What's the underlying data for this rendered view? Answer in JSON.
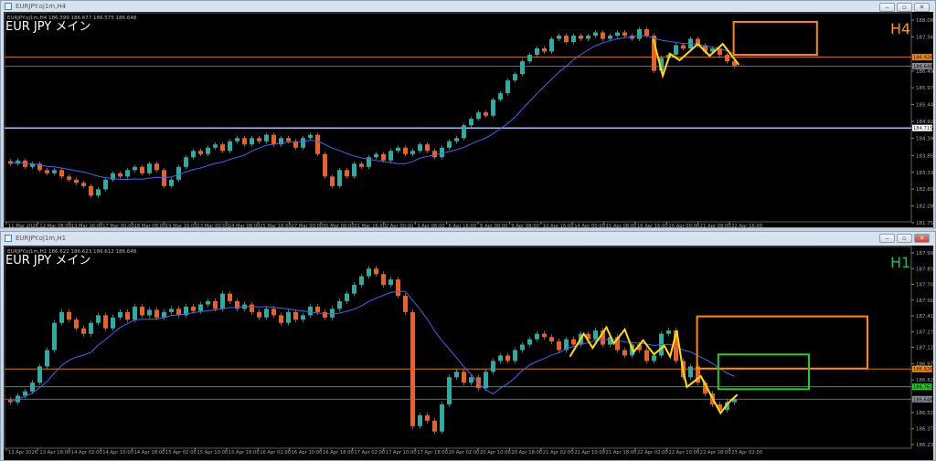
{
  "windows": [
    {
      "title": "EURJPY.oj1m,H4",
      "info": "EURJPY.oj1m,H4  186.599 186.677 186.575 186.648",
      "heading": "EUR JPY  メイン",
      "timeframe_label": "H4",
      "buttons": [
        "‒",
        "▫",
        "✕"
      ]
    },
    {
      "title": "EURJPY.oj1m,H1",
      "info": "EURJPY.oj1m,H1  186.622 186.623 186.612 186.648",
      "heading": "EUR JPY  メイン",
      "timeframe_label": "H1",
      "buttons": [
        "‒",
        "▫",
        "✕"
      ]
    }
  ],
  "colors": {
    "bull": "#1fb3a6",
    "bear": "#ff5a1a",
    "ma": "#4466ee",
    "zigzag": "#ffe000",
    "orange": "#ff8c00",
    "green": "#22cc22",
    "blueline": "#aab8ff"
  },
  "chart_data": [
    {
      "type": "candlestick",
      "title": "EURJPY H4",
      "ylim": [
        181.755,
        188.085
      ],
      "y_ticks": [
        "188.085",
        "187.560",
        "186.495",
        "185.970",
        "185.445",
        "184.920",
        "184.395",
        "183.855",
        "183.330",
        "182.805",
        "182.280",
        "181.755"
      ],
      "x_ticks": [
        "11 Mar 2026",
        "12 Mar 08:00",
        "13 Mar 16:00",
        "17 Mar 00:00",
        "18 Mar 08:00",
        "19 Mar 16:00",
        "23 Mar 00:00",
        "24 Mar 08:00",
        "25 Mar 16:00",
        "27 Mar 00:00",
        "30 Mar 08:00",
        "31 Mar 16:00",
        "2 Apr 00:00",
        "3 Apr 08:00",
        "6 Apr 16:00",
        "8 Apr 00:00",
        "9 Apr 08:00",
        "10 Apr 16:00",
        "14 Apr 00:00",
        "15 Apr 08:00",
        "16 Apr 16:00",
        "20 Apr 00:00",
        "21 Apr 08:00",
        "22 Apr 16:00"
      ],
      "closes": [
        183.6,
        183.7,
        183.5,
        183.6,
        183.4,
        183.3,
        183.4,
        183.2,
        183.1,
        183.0,
        182.9,
        182.6,
        182.8,
        183.1,
        183.3,
        183.2,
        183.4,
        183.5,
        183.3,
        183.6,
        183.4,
        182.9,
        183.1,
        183.5,
        183.8,
        184.0,
        183.9,
        184.1,
        184.2,
        184.0,
        184.3,
        184.4,
        184.2,
        184.4,
        184.3,
        184.5,
        184.2,
        184.4,
        184.3,
        184.1,
        184.4,
        184.5,
        183.9,
        183.2,
        182.9,
        183.4,
        183.2,
        183.6,
        183.5,
        183.8,
        183.9,
        183.7,
        184.0,
        184.1,
        183.9,
        184.0,
        184.2,
        184.0,
        183.8,
        184.1,
        184.3,
        184.4,
        184.8,
        185.0,
        185.2,
        185.1,
        185.6,
        185.8,
        186.2,
        186.4,
        186.8,
        187.0,
        187.2,
        187.1,
        187.5,
        187.6,
        187.4,
        187.6,
        187.5,
        187.6,
        187.7,
        187.5,
        187.6,
        187.7,
        187.6,
        187.5,
        187.8,
        187.6,
        186.5,
        186.9,
        187.0,
        187.3,
        187.2,
        187.5,
        187.3,
        187.1,
        187.2,
        187.0,
        186.8,
        186.65
      ],
      "hlines": [
        {
          "price": 186.926,
          "label": "186.926",
          "color": "orange"
        },
        {
          "price": 186.648,
          "label": "186.648",
          "color": "gray"
        },
        {
          "price": 184.715,
          "label": "184.715",
          "color": "blueline"
        }
      ],
      "zigzag": [
        [
          87.9,
          187.49
        ],
        [
          89.2,
          186.35
        ],
        [
          90.2,
          187.03
        ],
        [
          91.5,
          186.83
        ],
        [
          94,
          187.34
        ],
        [
          95.6,
          186.97
        ],
        [
          97.4,
          187.34
        ],
        [
          99.6,
          186.69
        ]
      ],
      "boxes": [
        {
          "from": 99.2,
          "to": 110.6,
          "top": 188.03,
          "bottom": 187.0,
          "color": "orange"
        }
      ]
    },
    {
      "type": "candlestick",
      "title": "EURJPY H1",
      "ylim": [
        186.23,
        187.995
      ],
      "y_ticks": [
        "187.995",
        "187.850",
        "187.705",
        "187.560",
        "187.415",
        "187.270",
        "187.125",
        "186.975",
        "186.825",
        "186.525",
        "186.375",
        "186.230"
      ],
      "x_ticks": [
        "13 Apr 2026",
        "13 Apr 18:00",
        "14 Apr 02:00",
        "14 Apr 10:00",
        "14 Apr 18:00",
        "15 Apr 02:00",
        "15 Apr 10:00",
        "15 Apr 18:00",
        "16 Apr 02:00",
        "16 Apr 10:00",
        "16 Apr 18:00",
        "17 Apr 02:00",
        "17 Apr 10:00",
        "17 Apr 18:00",
        "20 Apr 02:00",
        "20 Apr 10:00",
        "20 Apr 18:00",
        "21 Apr 02:00",
        "21 Apr 10:00",
        "21 Apr 18:00",
        "22 Apr 02:00",
        "22 Apr 10:00",
        "22 Apr 18:00",
        "23 Apr 02:00"
      ],
      "closes": [
        186.62,
        186.68,
        186.72,
        186.8,
        186.95,
        187.1,
        187.35,
        187.45,
        187.38,
        187.3,
        187.25,
        187.35,
        187.42,
        187.3,
        187.4,
        187.45,
        187.38,
        187.5,
        187.42,
        187.47,
        187.4,
        187.45,
        187.48,
        187.42,
        187.5,
        187.46,
        187.52,
        187.55,
        187.48,
        187.62,
        187.55,
        187.48,
        187.52,
        187.45,
        187.4,
        187.48,
        187.42,
        187.35,
        187.45,
        187.38,
        187.42,
        187.5,
        187.45,
        187.4,
        187.48,
        187.55,
        187.62,
        187.7,
        187.78,
        187.85,
        187.8,
        187.7,
        187.75,
        187.6,
        187.45,
        186.4,
        186.5,
        186.45,
        186.35,
        186.6,
        186.85,
        186.9,
        186.8,
        186.85,
        186.75,
        186.9,
        187.0,
        187.05,
        187.0,
        187.1,
        187.15,
        187.2,
        187.25,
        187.22,
        187.18,
        187.1,
        187.2,
        187.15,
        187.25,
        187.2,
        187.28,
        187.15,
        187.22,
        187.1,
        187.05,
        187.15,
        187.1,
        187.0,
        187.05,
        187.25,
        187.28,
        187.0,
        186.85,
        186.95,
        186.8,
        186.7,
        186.6,
        186.55,
        186.62,
        186.65
      ],
      "hlines": [
        {
          "price": 186.926,
          "label": "186.926",
          "color": "orange"
        },
        {
          "price": 186.762,
          "label": "186.762",
          "color": "green"
        },
        {
          "price": 186.648,
          "label": "186.648",
          "color": "gray"
        }
      ],
      "zigzag": [
        [
          76.5,
          187.04
        ],
        [
          78.4,
          187.25
        ],
        [
          79.6,
          187.12
        ],
        [
          81.5,
          187.31
        ],
        [
          82.5,
          187.16
        ],
        [
          84,
          187.29
        ],
        [
          85.2,
          187.08
        ],
        [
          86.5,
          187.19
        ],
        [
          88,
          187.06
        ],
        [
          89.4,
          187.14
        ],
        [
          90.2,
          187.04
        ],
        [
          91.1,
          187.28
        ],
        [
          92,
          186.9
        ],
        [
          92.5,
          186.76
        ],
        [
          94.4,
          186.86
        ],
        [
          95.9,
          186.67
        ],
        [
          97.1,
          186.52
        ],
        [
          98.1,
          186.61
        ],
        [
          99.4,
          186.69
        ]
      ],
      "boxes": [
        {
          "from": 94.2,
          "to": 117.5,
          "top": 187.41,
          "bottom": 186.93,
          "color": "orange"
        },
        {
          "from": 97.1,
          "to": 109.5,
          "top": 187.06,
          "bottom": 186.74,
          "color": "green"
        }
      ]
    }
  ]
}
